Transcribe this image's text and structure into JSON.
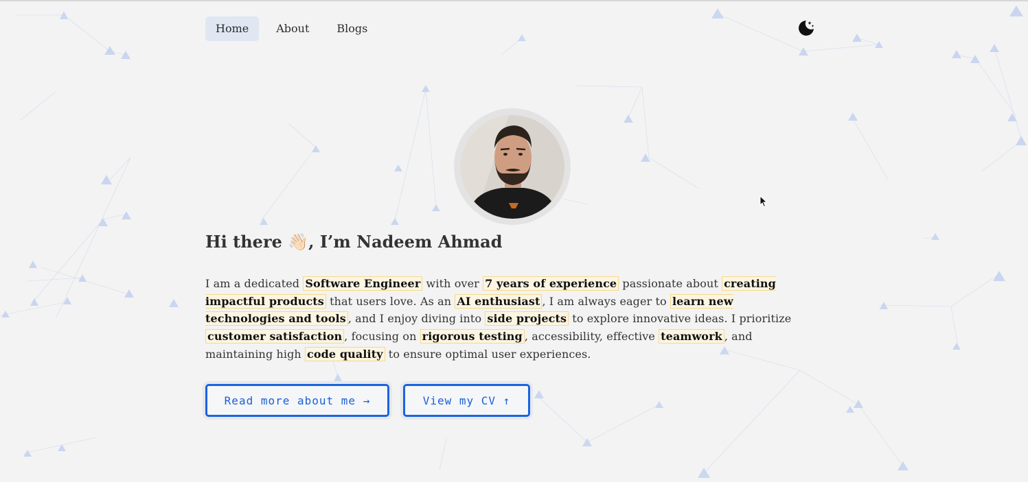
{
  "nav": {
    "items": [
      {
        "label": "Home",
        "active": true
      },
      {
        "label": "About",
        "active": false
      },
      {
        "label": "Blogs",
        "active": false
      }
    ],
    "theme_toggle_icon": "moon-stars-icon"
  },
  "hero": {
    "greeting": "Hi there 👋🏻, I’m Nadeem Ahmad",
    "bio": [
      {
        "t": "I am a dedicated "
      },
      {
        "t": "Software Engineer",
        "hl": true
      },
      {
        "t": " with over "
      },
      {
        "t": "7 years of experience",
        "hl": true
      },
      {
        "t": " passionate about "
      },
      {
        "t": "creating impactful products",
        "hl": true
      },
      {
        "t": " that users love. As an "
      },
      {
        "t": "AI enthusiast",
        "hl": true
      },
      {
        "t": ", I am always eager to "
      },
      {
        "t": "learn new technologies and tools",
        "hl": true
      },
      {
        "t": ", and I enjoy diving into "
      },
      {
        "t": "side projects",
        "hl": true
      },
      {
        "t": " to explore innovative ideas. I prioritize "
      },
      {
        "t": "customer satisfaction",
        "hl": true
      },
      {
        "t": ", focusing on "
      },
      {
        "t": "rigorous testing",
        "hl": true
      },
      {
        "t": ", accessibility, effective "
      },
      {
        "t": "teamwork",
        "hl": true
      },
      {
        "t": ", and maintaining high "
      },
      {
        "t": "code quality",
        "hl": true
      },
      {
        "t": " to ensure optimal user experiences."
      }
    ],
    "buttons": {
      "read_more": "Read more about me →",
      "view_cv": "View my CV ↑"
    }
  },
  "colors": {
    "accent": "#1a63e0",
    "highlight_border": "#f5d98a",
    "background": "#f3f3f3",
    "nav_active": "#e0e7f3"
  }
}
